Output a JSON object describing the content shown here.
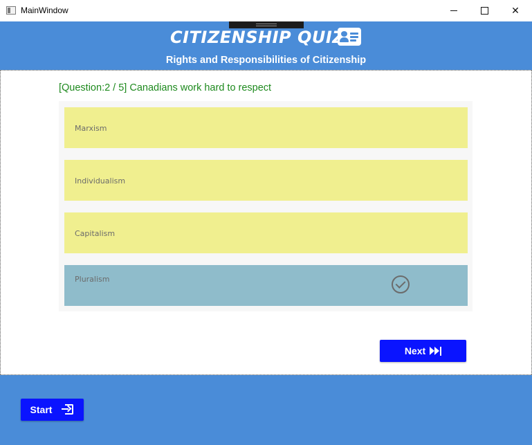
{
  "window": {
    "title": "MainWindow",
    "minimize_glyph": "minimize-icon",
    "maximize_glyph": "maximize-icon",
    "close_glyph": "✕"
  },
  "header": {
    "title": "CITIZENSHIP QUIZ",
    "title_icon": "id-card-icon",
    "subtitle": "Rights and Responsibilities of Citizenship",
    "background": "#4a8cd8"
  },
  "quiz": {
    "question_text": "[Question:2 / 5] Canadians work hard to respect",
    "question_color": "#1e8a1e",
    "answers": [
      {
        "label": "Marxism",
        "selected": false
      },
      {
        "label": "Individualism",
        "selected": false
      },
      {
        "label": "Capitalism",
        "selected": false
      },
      {
        "label": "Pluralism",
        "selected": true
      }
    ],
    "answer_color": "#f0ef8f",
    "selected_answer_color": "#8fbccb",
    "selected_icon": "check-circle-icon",
    "next_label": "Next",
    "next_icon": "skip-next-icon"
  },
  "footer": {
    "start_label": "Start",
    "start_icon": "login-icon",
    "button_color": "#0a14ff"
  }
}
